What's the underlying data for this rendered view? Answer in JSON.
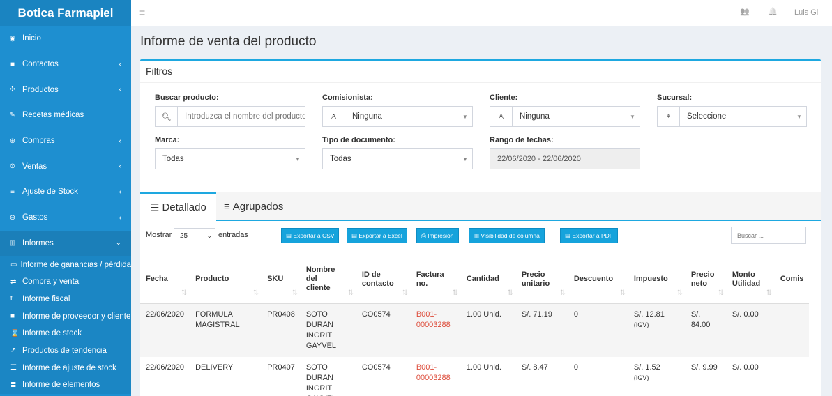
{
  "app": {
    "brand": "Botica Farmapiel"
  },
  "sidebar": {
    "items": [
      {
        "label": "Inicio",
        "icon": "dashboard-icon",
        "glyph": "◉",
        "chev": ""
      },
      {
        "label": "Contactos",
        "icon": "address-book-icon",
        "glyph": "■",
        "chev": "‹"
      },
      {
        "label": "Productos",
        "icon": "cubes-icon",
        "glyph": "✣",
        "chev": "‹"
      },
      {
        "label": "Recetas médicas",
        "icon": "edit-icon",
        "glyph": "✎",
        "chev": ""
      },
      {
        "label": "Compras",
        "icon": "plus-circle-icon",
        "glyph": "⊕",
        "chev": "‹"
      },
      {
        "label": "Ventas",
        "icon": "arrow-circle-up-icon",
        "glyph": "⊙",
        "chev": "‹"
      },
      {
        "label": "Ajuste de Stock",
        "icon": "database-icon",
        "glyph": "≡",
        "chev": "‹"
      },
      {
        "label": "Gastos",
        "icon": "minus-circle-icon",
        "glyph": "⊖",
        "chev": "‹"
      },
      {
        "label": "Informes",
        "icon": "bar-chart-icon",
        "glyph": "▥",
        "chev": "⌄"
      }
    ],
    "submenu": [
      {
        "label": "Informe de ganancias / pérdidas",
        "icon": "money-icon",
        "glyph": "▭"
      },
      {
        "label": "Compra y venta",
        "icon": "exchange-icon",
        "glyph": "⇄"
      },
      {
        "label": "Informe fiscal",
        "icon": "tumblr-icon",
        "glyph": "t"
      },
      {
        "label": "Informe de proveedor y cliente",
        "icon": "address-book-icon",
        "glyph": "■"
      },
      {
        "label": "Informe de stock",
        "icon": "hourglass-icon",
        "glyph": "⌛"
      },
      {
        "label": "Productos de tendencia",
        "icon": "line-chart-icon",
        "glyph": "↗"
      },
      {
        "label": "Informe de ajuste de stock",
        "icon": "sliders-icon",
        "glyph": "☰"
      },
      {
        "label": "Informe de elementos",
        "icon": "list-icon",
        "glyph": "≣"
      }
    ]
  },
  "topbar": {
    "menu_glyph": "≡",
    "user": "Luis Gil",
    "users_glyph": "👥",
    "bell_glyph": "🔔"
  },
  "page": {
    "title": "Informe de venta del producto"
  },
  "filters": {
    "title": "Filtros",
    "buscar_label": "Buscar producto:",
    "buscar_placeholder": "Introduzca el nombre del producto",
    "comisionista_label": "Comisionista:",
    "comisionista_value": "Ninguna",
    "cliente_label": "Cliente:",
    "cliente_value": "Ninguna",
    "sucursal_label": "Sucursal:",
    "sucursal_value": "Seleccione",
    "marca_label": "Marca:",
    "marca_value": "Todas",
    "tipo_label": "Tipo de documento:",
    "tipo_value": "Todas",
    "rango_label": "Rango de fechas:",
    "rango_value": "22/06/2020 - 22/06/2020"
  },
  "tabs": {
    "detallado": "Detallado",
    "agrupados": "Agrupados"
  },
  "table_controls": {
    "mostrar": "Mostrar",
    "entries_value": "25",
    "entradas": "entradas",
    "btn_csv": "Exportar a CSV",
    "btn_excel": "Exportar a Excel",
    "btn_print": "Impresión",
    "btn_vis": "Visibilidad de columna",
    "btn_pdf": "Exportar a PDF",
    "search_placeholder": "Buscar ..."
  },
  "table": {
    "headers": [
      "Fecha",
      "Producto",
      "SKU",
      "Nombre del cliente",
      "ID de contacto",
      "Factura no.",
      "Cantidad",
      "Precio unitario",
      "Descuento",
      "Impuesto",
      "Precio neto",
      "Monto Utilidad",
      "Comis"
    ],
    "rows": [
      {
        "fecha": "22/06/2020",
        "producto": "FORMULA MAGISTRAL",
        "sku": "PR0408",
        "cliente": "SOTO DURAN INGRIT GAYVEL",
        "contacto": "CO0574",
        "factura": "B001-00003288",
        "cantidad": "1.00 Unid.",
        "precio": "S/. 71.19",
        "descuento": "0",
        "impuesto": "S/. 12.81",
        "igv": "(IGV)",
        "neto": "S/. 84.00",
        "utilidad": "S/. 0.00"
      },
      {
        "fecha": "22/06/2020",
        "producto": "DELIVERY",
        "sku": "PR0407",
        "cliente": "SOTO DURAN INGRIT GAYVEL",
        "contacto": "CO0574",
        "factura": "B001-00003288",
        "cantidad": "1.00 Unid.",
        "precio": "S/. 8.47",
        "descuento": "0",
        "impuesto": "S/. 1.52",
        "igv": "(IGV)",
        "neto": "S/. 9.99",
        "utilidad": "S/. 0.00"
      }
    ]
  }
}
